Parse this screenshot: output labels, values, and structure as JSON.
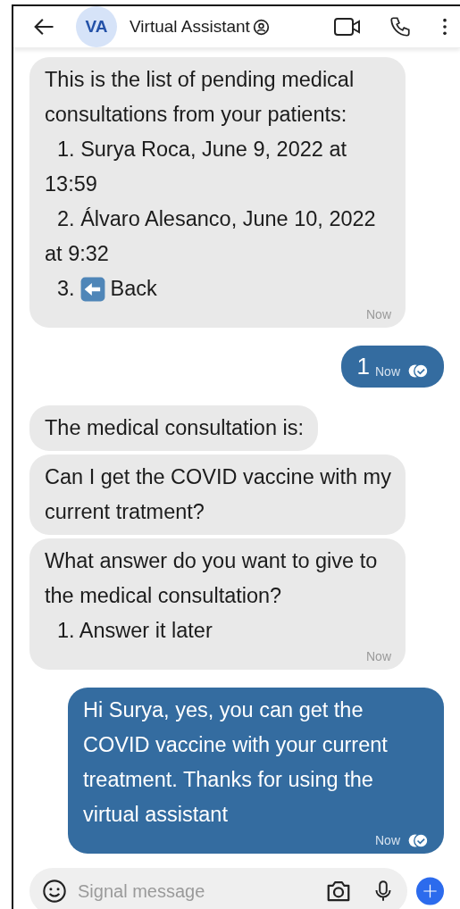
{
  "header": {
    "avatar_initials": "VA",
    "title": "Virtual Assistant"
  },
  "messages": [
    {
      "outgoing": false,
      "parts": [
        {
          "kind": "text",
          "text": "This is the list of pending medical consultations from your patients:"
        },
        {
          "kind": "item",
          "text": "1. Surya Roca, June 9, 2022 at 13:59"
        },
        {
          "kind": "item",
          "text": "2. Álvaro Alesanco, June 10, 2022 at 9:32"
        },
        {
          "kind": "icon_item",
          "number": "3.",
          "text": "Back"
        }
      ],
      "time": "Now"
    },
    {
      "outgoing": true,
      "parts": [
        {
          "kind": "text",
          "text": "1"
        }
      ],
      "time": "Now",
      "read": true
    },
    {
      "outgoing": false,
      "parts": [
        {
          "kind": "text",
          "text": "The medical consultation is:"
        }
      ]
    },
    {
      "outgoing": false,
      "parts": [
        {
          "kind": "text",
          "text": "Can I get the COVID vaccine with my current tratment?"
        }
      ]
    },
    {
      "outgoing": false,
      "parts": [
        {
          "kind": "text",
          "text": "What answer do you want to give to the medical consultation?"
        },
        {
          "kind": "item",
          "text": "1. Answer it later"
        }
      ],
      "time": "Now"
    },
    {
      "outgoing": true,
      "parts": [
        {
          "kind": "text",
          "text": "Hi Surya, yes, you can get the COVID vaccine with your current treatment. Thanks for using the virtual assistant"
        }
      ],
      "time": "Now",
      "read": true
    }
  ],
  "composer": {
    "placeholder": "Signal message"
  }
}
